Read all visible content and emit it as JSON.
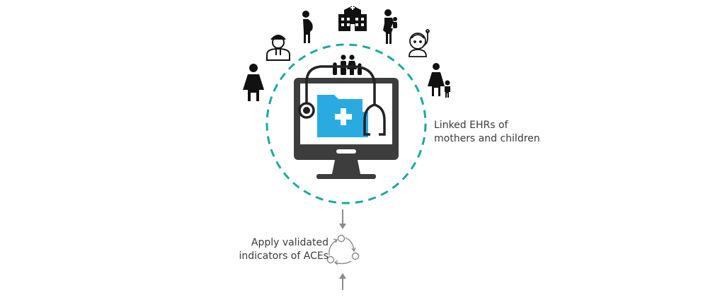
{
  "labels": {
    "ehr_line1": "Linked EHRs of",
    "ehr_line2": "mothers and children",
    "aces_line1": "Apply validated",
    "aces_line2": "indicators of ACEs"
  },
  "icons": [
    "woman-icon",
    "doctor-icon",
    "pregnant-woman-icon",
    "hospital-icon",
    "mother-holding-child-icon",
    "baby-stethoscope-icon",
    "mother-with-child-icon",
    "family-icon",
    "monitor-icon",
    "medical-folder-icon",
    "stethoscope-icon",
    "cycle-icon",
    "arrow-down-icon",
    "arrow-up-icon"
  ],
  "colors": {
    "accent_teal": "#1aa9a0",
    "folder_blue": "#29abe2",
    "icon_dark": "#111111",
    "arrow_gray": "#8a8a8a"
  }
}
